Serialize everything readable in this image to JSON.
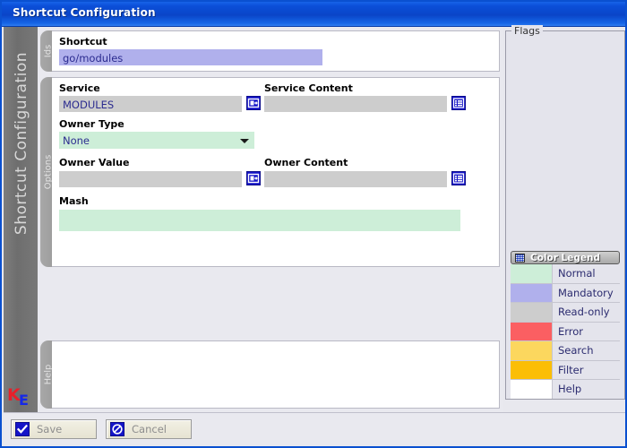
{
  "window": {
    "title": "Shortcut Configuration"
  },
  "sidebar": {
    "vertical_title": "Shortcut Configuration",
    "logo_first": "K",
    "logo_second": "E"
  },
  "sections": {
    "ids": {
      "tab_label": "Ids",
      "shortcut": {
        "label": "Shortcut",
        "value": "go/modules",
        "color_state": "Mandatory"
      }
    },
    "options": {
      "tab_label": "Options",
      "service": {
        "label": "Service",
        "value": "MODULES",
        "color_state": "Read-only",
        "picker_icon": "picker-icon"
      },
      "service_content": {
        "label": "Service Content",
        "value": "",
        "color_state": "Read-only",
        "list_icon": "list-icon"
      },
      "owner_type": {
        "label": "Owner Type",
        "value": "None",
        "color_state": "Normal"
      },
      "owner_value": {
        "label": "Owner Value",
        "value": "",
        "color_state": "Read-only",
        "picker_icon": "picker-icon"
      },
      "owner_content": {
        "label": "Owner Content",
        "value": "",
        "color_state": "Read-only",
        "list_icon": "list-icon"
      },
      "mash": {
        "label": "Mash",
        "value": "",
        "color_state": "Normal"
      }
    },
    "help": {
      "tab_label": "Help",
      "text": ""
    }
  },
  "flags": {
    "title": "Flags",
    "items": []
  },
  "color_legend": {
    "title": "Color Legend",
    "icon": "grid-icon",
    "rows": [
      {
        "label": "Normal",
        "color": "#cdeed8"
      },
      {
        "label": "Mandatory",
        "color": "#b0b0ec"
      },
      {
        "label": "Read-only",
        "color": "#cdcdcd"
      },
      {
        "label": "Error",
        "color": "#fb5f62"
      },
      {
        "label": "Search",
        "color": "#fcd75e"
      },
      {
        "label": "Filter",
        "color": "#fbbe06"
      },
      {
        "label": "Help",
        "color": "#ffffff"
      }
    ]
  },
  "buttons": {
    "save": {
      "label": "Save",
      "icon": "check-icon"
    },
    "cancel": {
      "label": "Cancel",
      "icon": "no-entry-icon"
    }
  }
}
